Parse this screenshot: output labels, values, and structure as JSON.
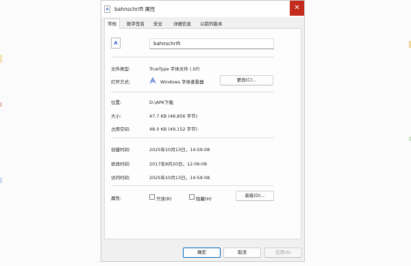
{
  "window": {
    "title": "bahnschrift 属性",
    "close_glyph": "✕",
    "file_glyph": "A"
  },
  "tabs": [
    "常规",
    "数字签名",
    "安全",
    "详细信息",
    "以前的版本"
  ],
  "file_name": "bahnschrift",
  "rows": {
    "file_type": {
      "label": "文件类型:",
      "value": "TrueType 字体文件 (.ttf)"
    },
    "open_with": {
      "label": "打开方式:",
      "value": "Windows 字体查看器",
      "change_button": "更改(C)..."
    },
    "location": {
      "label": "位置:",
      "value": "D:\\APK下载"
    },
    "size": {
      "label": "大小:",
      "value": "47.7 KB (48,856 字节)"
    },
    "size_on_disk": {
      "label": "占用空间:",
      "value": "48.0 KB (49,152 字节)"
    },
    "created": {
      "label": "创建时间:",
      "value": "2025年10月13日，14:59:08"
    },
    "modified": {
      "label": "修改时间:",
      "value": "2017年8月20日，12:06:08"
    },
    "accessed": {
      "label": "访问时间:",
      "value": "2025年10月13日，14:59:08"
    },
    "attributes": {
      "label": "属性:",
      "readonly": "只读(R)",
      "hidden": "隐藏(H)",
      "advanced_button": "高级(D)..."
    }
  },
  "footer": {
    "ok": "确定",
    "cancel": "取消",
    "apply": "应用(A)"
  },
  "colors": {
    "close_red": "#c42b1c",
    "accent": "#0067c0"
  }
}
